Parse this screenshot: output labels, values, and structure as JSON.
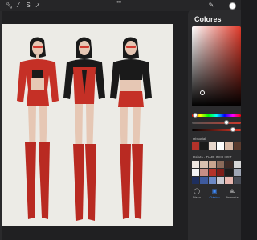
{
  "toolbar": {
    "icons": [
      "wrench-icon",
      "magic-wand-icon",
      "selection-icon",
      "transform-arrow-icon"
    ],
    "more_glyph": "•••",
    "current_color": "#ffffff"
  },
  "canvas": {
    "background": "#ecebe6",
    "figures": [
      {
        "name": "figure-red-jacket",
        "skin": "#e6c7b4",
        "outfit": "#c53026",
        "boots": "#b92a22"
      },
      {
        "name": "figure-black-bodysuit",
        "skin": "#e6c7b4",
        "outfit": "#c53026",
        "top": "#1a1a1a",
        "boots": "#b92a22"
      },
      {
        "name": "figure-black-crop-top",
        "skin": "#e6c7b4",
        "outfit": "#c53026",
        "top": "#1a1a1a",
        "boots": "#b92a22"
      }
    ]
  },
  "panel": {
    "title": "Colores",
    "history_label": "Historial",
    "palette_label": "Paleta · DARLINILLUST",
    "history": [
      "#b3322a",
      "#1a1a1a",
      "#e7d7cc",
      "#ffffff",
      "#d8b9a6",
      "#5a3b2e"
    ],
    "palette": [
      "#efe7e1",
      "#d9c1b0",
      "#c9a58f",
      "#8a6a5a",
      "#3b2a26",
      "#d7d7d7",
      "#f4f4f4",
      "#c98f86",
      "#b3322a",
      "#7d1d19",
      "#1d1d1d",
      "#9fa6b5",
      "#1e2f5e",
      "#3e5a9e",
      "#6c89c6",
      "#c9c9d1",
      "#e8b7b0",
      "#494d57"
    ],
    "nav": [
      {
        "label": "Disco",
        "icon": "disc-icon",
        "glyph": "◯",
        "active": false
      },
      {
        "label": "Clásico",
        "icon": "square-icon",
        "glyph": "▣",
        "active": true
      },
      {
        "label": "Armonía",
        "icon": "harmony-icon",
        "glyph": "⟁",
        "active": false
      }
    ]
  }
}
